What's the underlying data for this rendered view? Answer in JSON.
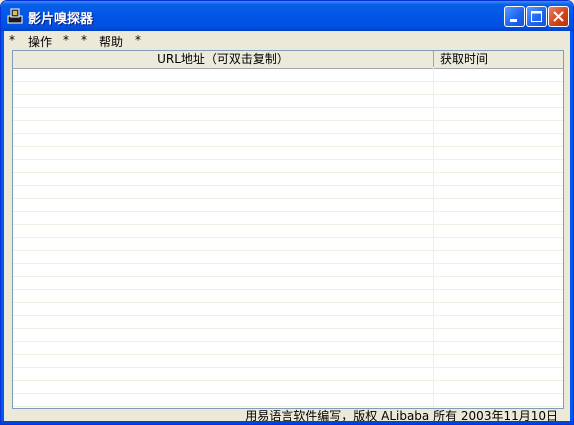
{
  "window": {
    "title": "影片嗅探器",
    "icon": "app-icon",
    "controls": {
      "minimize": "minimize-icon",
      "maximize": "maximize-icon",
      "close": "close-icon"
    }
  },
  "menubar": {
    "items": [
      {
        "label": "*"
      },
      {
        "label": "操作"
      },
      {
        "label": "*"
      },
      {
        "label": "*"
      },
      {
        "label": "帮助"
      },
      {
        "label": "*"
      }
    ]
  },
  "list": {
    "columns": [
      {
        "label": "URL地址（可双击复制）"
      },
      {
        "label": "获取时间"
      }
    ],
    "rows": []
  },
  "status": {
    "text": "用易语言软件编写，版权 ALibaba 所有  2003年11月10日"
  },
  "colors": {
    "title_bar": "#0055e5",
    "window_bg": "#ece9d8",
    "list_bg": "#ffffff",
    "grid_line": "#eef0e6"
  }
}
